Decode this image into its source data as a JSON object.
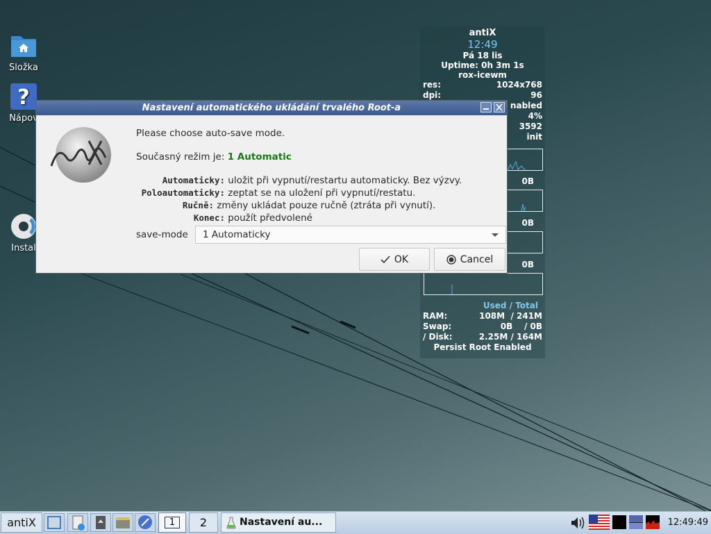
{
  "desktop": {
    "icons": [
      {
        "label": "Složka"
      },
      {
        "label": "Nápov"
      },
      {
        "label": "Instal"
      }
    ]
  },
  "conky": {
    "hostname": "antiX",
    "time": "12:49",
    "date": "Pá 18 lis",
    "uptime": "Uptime: 0h 3m 1s",
    "wm": "rox-icewm",
    "rows": [
      {
        "key": "res:",
        "value": "1024x768"
      },
      {
        "key": "dpi:",
        "value": "96"
      },
      {
        "key": "",
        "value": "nabled"
      },
      {
        "key": "",
        "value": "4%"
      },
      {
        "key": "",
        "value": "3592"
      },
      {
        "key": "",
        "value": "init"
      }
    ],
    "net_labels": [
      "0B",
      "0B",
      "0B"
    ],
    "mem_header": "Used / Total",
    "mem_rows": [
      {
        "key": "RAM:",
        "value": "108M  / 241M"
      },
      {
        "key": "Swap:",
        "value": "0B    / 0B"
      },
      {
        "key": "/ Disk:",
        "value": "2.25M / 164M"
      }
    ],
    "footer": "Persist Root Enabled"
  },
  "dialog": {
    "title": "Nastavení automatického ukládání trvalého Root-a",
    "prompt": "Please choose auto-save mode.",
    "current_label": "Současný režim je:",
    "current_value": "1 Automatic",
    "current_color": "#1a7a1a",
    "modes": [
      {
        "key": "Automaticky:",
        "desc": "uložit při vypnutí/restartu automaticky. Bez výzvy."
      },
      {
        "key": "Poloautomaticky:",
        "desc": "zeptat se na uložení při vypnutí/restatu."
      },
      {
        "key": "Ručně:",
        "desc": "změny ukládat pouze ručně (ztráta při vynutí)."
      },
      {
        "key": "Konec:",
        "desc": "použít předvolené"
      }
    ],
    "combo_label": "save-mode",
    "combo_value": "1 Automaticky",
    "ok_label": "OK",
    "cancel_label": "Cancel"
  },
  "taskbar": {
    "start_label": "antiX",
    "workspaces": [
      "1",
      "2"
    ],
    "task_label": "Nastavení au...",
    "clock": "12:49:49"
  }
}
